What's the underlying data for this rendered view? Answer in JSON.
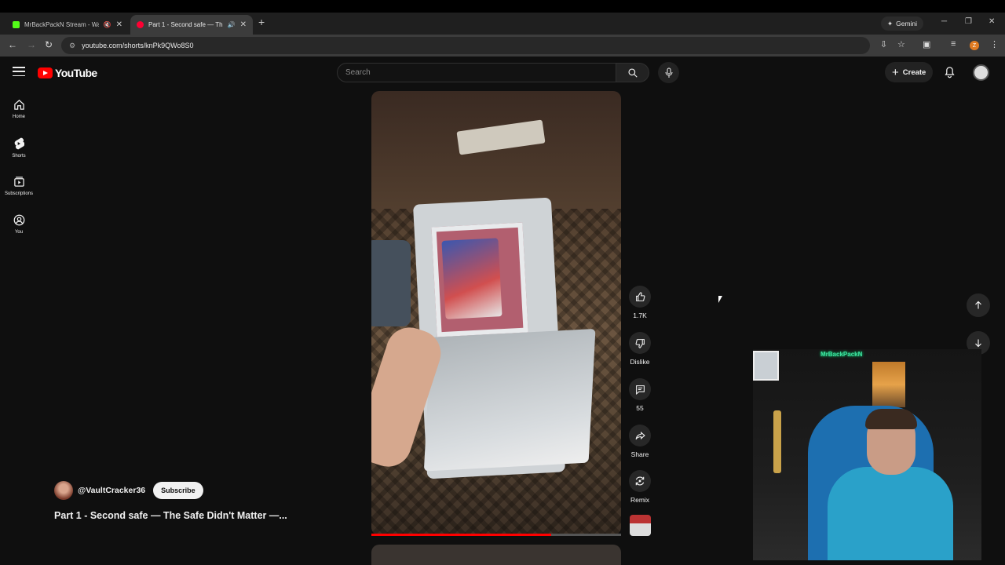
{
  "browser": {
    "tabs": [
      {
        "title": "MrBackPackN Stream - Wat",
        "favicon_color": "#53fc18"
      },
      {
        "title": "Part 1 - Second safe — The",
        "favicon_color": "#ff0033"
      }
    ],
    "gemini_label": "Gemini",
    "url": "youtube.com/shorts/knPk9QWo8S0",
    "profile_initial": "Z"
  },
  "youtube": {
    "logo_text": "YouTube",
    "search_placeholder": "Search",
    "create_label": "Create",
    "sidebar": [
      {
        "label": "Home",
        "icon": "home-icon"
      },
      {
        "label": "Shorts",
        "icon": "shorts-icon"
      },
      {
        "label": "Subscriptions",
        "icon": "subscriptions-icon"
      },
      {
        "label": "You",
        "icon": "you-icon"
      }
    ],
    "actions": {
      "like_count": "1.7K",
      "dislike_label": "Dislike",
      "comment_count": "55",
      "share_label": "Share",
      "remix_label": "Remix"
    },
    "channel_name": "@VaultCracker36",
    "subscribe_label": "Subscribe",
    "video_title": "Part 1 - Second safe — The Safe Didn't Matter —...",
    "progress": 0.72,
    "webcam_logo_text": "MrBackPackN"
  },
  "colors": {
    "accent": "#ff0000",
    "background": "#0f0f0f"
  }
}
